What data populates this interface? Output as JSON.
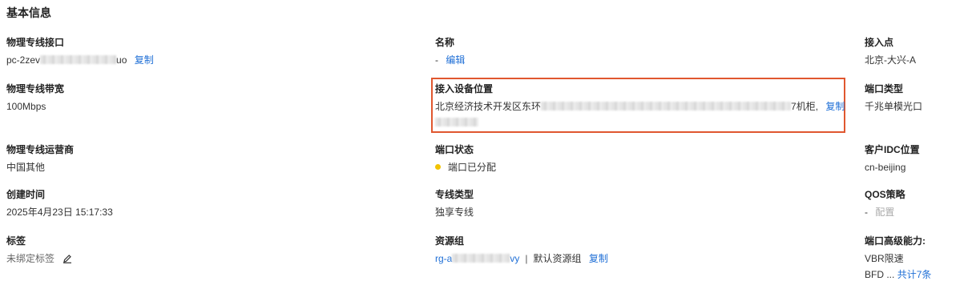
{
  "section_title": "基本信息",
  "col1": {
    "interface": {
      "label": "物理专线接口",
      "value_prefix": "pc-2zev",
      "value_suffix": "uo",
      "copy": "复制"
    },
    "bandwidth": {
      "label": "物理专线带宽",
      "value": "100Mbps"
    },
    "carrier": {
      "label": "物理专线运营商",
      "value": "中国其他"
    },
    "created": {
      "label": "创建时间",
      "value": "2025年4月23日 15:17:33"
    },
    "tags": {
      "label": "标签",
      "value": "未绑定标签"
    }
  },
  "col2": {
    "name": {
      "label": "名称",
      "value": "-",
      "edit": "编辑"
    },
    "device_location": {
      "label": "接入设备位置",
      "value_prefix": "北京经济技术开发区东环",
      "value_suffix": "7机柜,",
      "copy": "复制"
    },
    "port_status": {
      "label": "端口状态",
      "value": "端口已分配"
    },
    "line_type": {
      "label": "专线类型",
      "value": "独享专线"
    },
    "resource_group": {
      "label": "资源组",
      "id_prefix": "rg-a",
      "id_suffix": "vy",
      "separator": "|",
      "name": "默认资源组",
      "copy": "复制"
    }
  },
  "col3": {
    "access_point": {
      "label": "接入点",
      "value": "北京-大兴-A"
    },
    "port_type": {
      "label": "端口类型",
      "value": "千兆单模光口"
    },
    "idc_location": {
      "label": "客户IDC位置",
      "value": "cn-beijing"
    },
    "qos": {
      "label": "QOS策略",
      "value": "-",
      "action": "配置"
    },
    "advanced": {
      "label": "端口高级能力:",
      "line1": "VBR限速",
      "line2_prefix": "BFD ...",
      "line2_link": "共计7条"
    }
  },
  "colors": {
    "link": "#1f6fd6",
    "highlight_border": "#e0572f",
    "status_dot": "#f2c300"
  }
}
